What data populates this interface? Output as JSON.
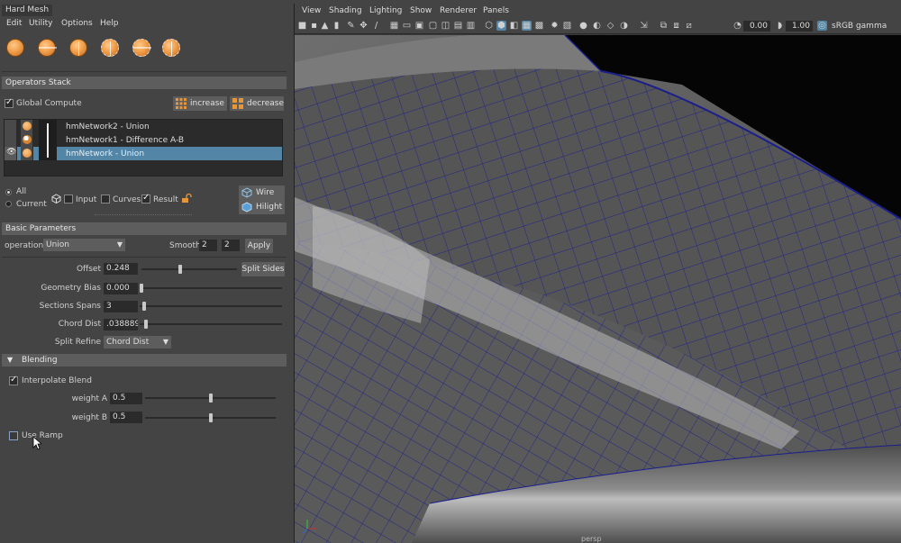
{
  "window": {
    "title": "Hard Mesh"
  },
  "menu": {
    "edit": "Edit",
    "utility": "Utility",
    "options": "Options",
    "help": "Help"
  },
  "shelf": {
    "icons": [
      "sphere-icon",
      "sphere-cut-icon",
      "sphere-split-icon",
      "sphere-half-icon",
      "sphere-dashed-icon",
      "sphere-dashed-split-icon"
    ]
  },
  "operators_stack": {
    "header": "Operators Stack",
    "global_compute_label": "Global Compute",
    "global_compute_checked": true,
    "increase_label": "increase",
    "decrease_label": "decrease",
    "items": [
      {
        "label": "hmNetwork2 - Union",
        "selected": false
      },
      {
        "label": "hmNetwork1 - Difference A-B",
        "selected": false
      },
      {
        "label": "hmNetwork - Union",
        "selected": true
      }
    ],
    "display": {
      "all_label": "All",
      "current_label": "Current",
      "selected_mode": "All",
      "input_label": "Input",
      "curves_label": "Curves",
      "result_label": "Result",
      "result_checked": true,
      "wire_label": "Wire",
      "hilight_label": "Hilight"
    }
  },
  "basic_parameters": {
    "header": "Basic Parameters",
    "operation_label": "operation",
    "operation_value": "Union",
    "smooth_label": "Smooth",
    "smooth_a": "2",
    "smooth_b": "2",
    "apply_label": "Apply",
    "offset_label": "Offset",
    "offset_value": "0.248",
    "offset_fraction": 0.4,
    "split_sides_label": "Split Sides",
    "geometry_bias_label": "Geometry Bias",
    "geometry_bias_value": "0.000",
    "geometry_bias_fraction": 0.0,
    "sections_spans_label": "Sections Spans",
    "sections_spans_value": "3",
    "sections_spans_fraction": 0.02,
    "chord_dist_label": "Chord Dist",
    "chord_dist_value": ".038889",
    "chord_dist_fraction": 0.03,
    "split_refine_label": "Split Refine",
    "split_refine_value": "Chord Dist"
  },
  "blending": {
    "header": "Blending",
    "interpolate_label": "Interpolate Blend",
    "interpolate_checked": true,
    "weight_a_label": "weight A",
    "weight_a_value": "0.5",
    "weight_a_fraction": 0.5,
    "weight_b_label": "weight B",
    "weight_b_value": "0.5",
    "weight_b_fraction": 0.5,
    "use_ramp_label": "Use Ramp",
    "use_ramp_checked": false
  },
  "viewport": {
    "menu": {
      "view": "View",
      "shading": "Shading",
      "lighting": "Lighting",
      "show": "Show",
      "renderer": "Renderer",
      "panels": "Panels"
    },
    "exposure_value": "0.00",
    "gamma_value": "1.00",
    "color_space": "sRGB gamma",
    "camera_label": "persp",
    "wire_color": "#1a1f8c"
  }
}
